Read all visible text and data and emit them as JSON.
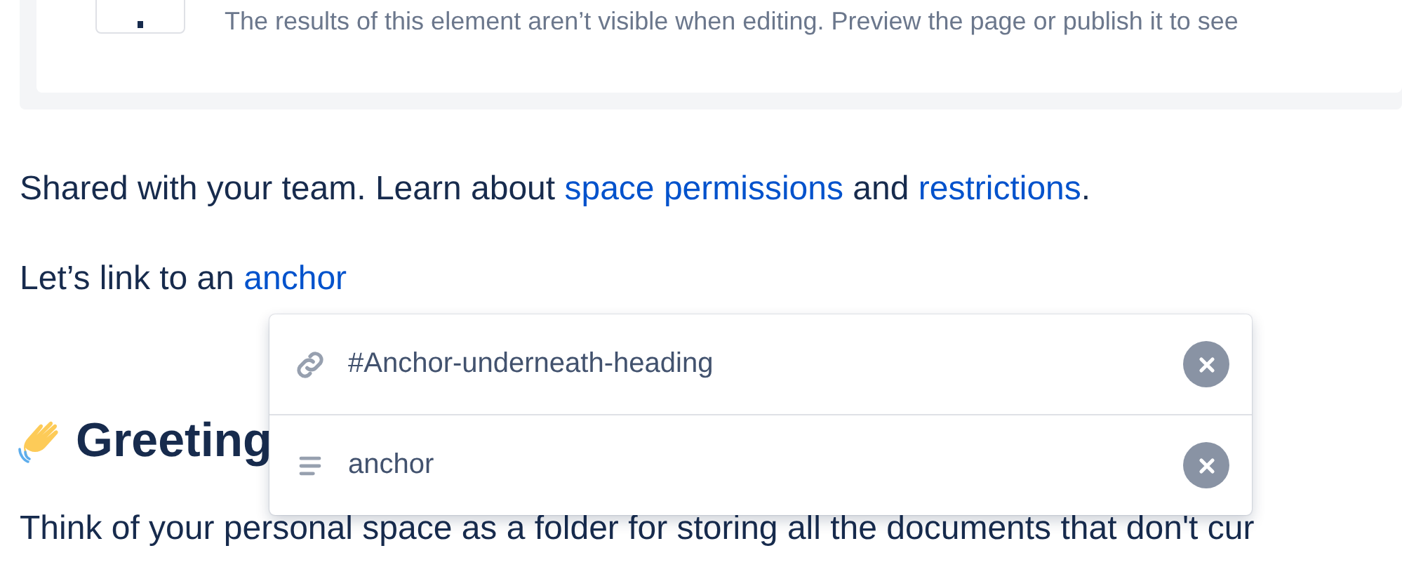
{
  "macro_placeholder": {
    "message": "The results of this element aren’t visible when editing. Preview the page or publish it to see"
  },
  "paragraphs": [
    {
      "parts": [
        {
          "kind": "text",
          "text": "Shared with your team. Learn about "
        },
        {
          "kind": "link",
          "text": "space permissions"
        },
        {
          "kind": "text",
          "text": " and "
        },
        {
          "kind": "link",
          "text": "restrictions"
        },
        {
          "kind": "text",
          "text": "."
        }
      ]
    },
    {
      "parts": [
        {
          "kind": "text",
          "text": "Let’s link to an "
        },
        {
          "kind": "link",
          "text": "anchor"
        }
      ]
    }
  ],
  "link_popup": {
    "rows": [
      {
        "kind": "url",
        "value": "#Anchor-underneath-heading"
      },
      {
        "kind": "text",
        "value": "anchor"
      }
    ]
  },
  "heading": {
    "text": "Greeting"
  },
  "body": {
    "text": "Think of your personal space as a folder for storing all the documents that don't cur"
  }
}
